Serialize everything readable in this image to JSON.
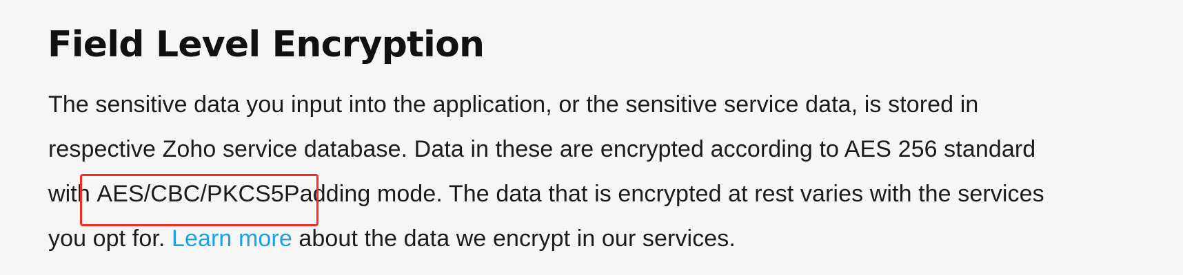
{
  "section": {
    "title": "Field Level Encryption",
    "paragraph": {
      "line1": "The sensitive data you input into the application, or the sensitive service data, is stored in",
      "line2": "respective Zoho service database. Data in these are encrypted according to AES 256 standard",
      "line3_prefix": "with ",
      "line3_highlight": "AES/CBC/PKCS5Padding",
      "line3_suffix": " mode. The data that is encrypted at rest varies with the services",
      "line4_prefix": "you opt for. ",
      "link_text": "Learn more",
      "line4_suffix": " about the data we encrypt in our services."
    }
  },
  "annotation": {
    "highlight_color": "#ff2a1f"
  },
  "theme": {
    "background": "#f6f6f6",
    "text": "#111111",
    "link": "#1aa0e8"
  }
}
